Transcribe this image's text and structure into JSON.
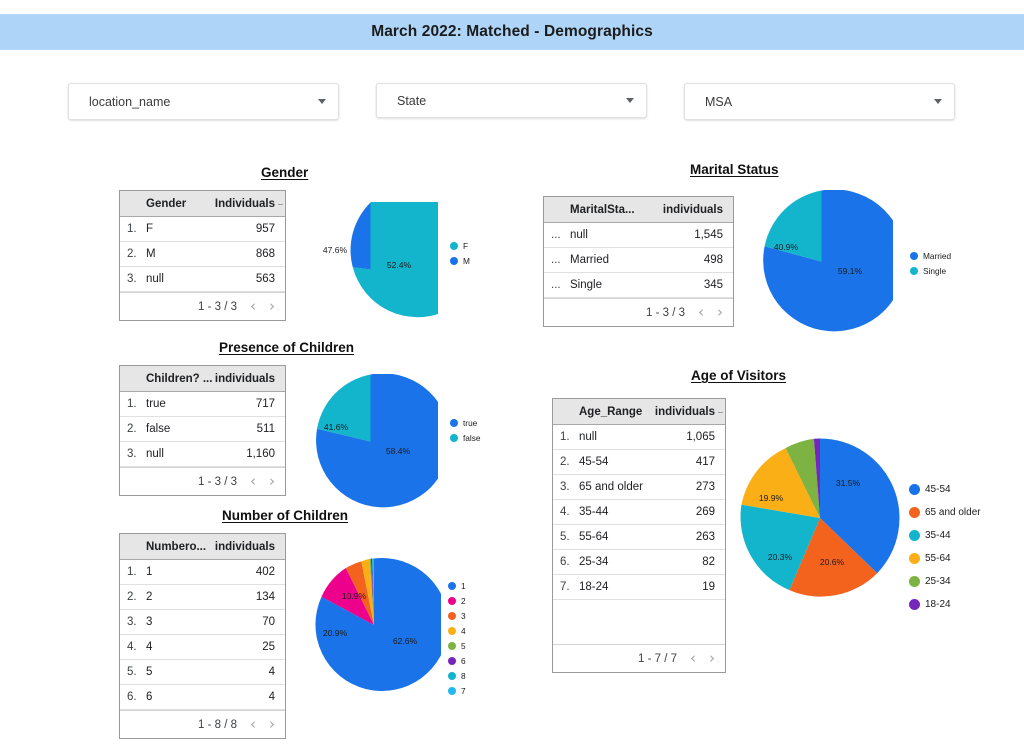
{
  "header": {
    "title": "March 2022: Matched - Demographics",
    "background": "#aed4f7"
  },
  "filters": [
    {
      "name": "location_name",
      "label": "location_name"
    },
    {
      "name": "state",
      "label": "State"
    },
    {
      "name": "msa",
      "label": "MSA"
    }
  ],
  "palette": {
    "blue": "#1a73e8",
    "teal": "#12b5cb",
    "orange": "#f4631e",
    "amber": "#fbaf17",
    "green": "#7cb342",
    "purple": "#7627bb",
    "pink": "#ec008c",
    "cyan": "#12b5cb",
    "lightblue": "#22b7f2"
  },
  "sections": [
    {
      "id": "gender",
      "title": "Gender",
      "table": {
        "columns": [
          "Gender",
          "Individuals"
        ],
        "rows": [
          {
            "n": "1.",
            "key": "F",
            "val": "957"
          },
          {
            "n": "2.",
            "key": "M",
            "val": "868"
          },
          {
            "n": "3.",
            "key": "null",
            "val": "563"
          }
        ],
        "footer": "1 - 3 / 3"
      },
      "chart_data": {
        "type": "pie",
        "title": "Gender",
        "categories": [
          "F",
          "M"
        ],
        "values": [
          957,
          868
        ],
        "percents": [
          "52.4%",
          "47.6%"
        ],
        "colors": [
          "#12b5cb",
          "#1a73e8"
        ],
        "legend_position": "right",
        "note": "null (563) excluded from pie"
      }
    },
    {
      "id": "marital",
      "title": "Marital Status",
      "table": {
        "columns": [
          "MaritalSta...",
          "individuals"
        ],
        "rows": [
          {
            "n": "...",
            "key": "null",
            "val": "1,545"
          },
          {
            "n": "...",
            "key": "Married",
            "val": "498"
          },
          {
            "n": "...",
            "key": "Single",
            "val": "345"
          }
        ],
        "footer": "1 - 3 / 3"
      },
      "chart_data": {
        "type": "pie",
        "title": "Marital Status",
        "categories": [
          "Married",
          "Single"
        ],
        "values": [
          498,
          345
        ],
        "percents": [
          "59.1%",
          "40.9%"
        ],
        "colors": [
          "#1a73e8",
          "#12b5cb"
        ],
        "legend_position": "right",
        "note": "null (1,545) excluded from pie"
      }
    },
    {
      "id": "children",
      "title": "Presence of Children",
      "table": {
        "columns": [
          "Children? ...",
          "individuals"
        ],
        "rows": [
          {
            "n": "1.",
            "key": "true",
            "val": "717"
          },
          {
            "n": "2.",
            "key": "false",
            "val": "511"
          },
          {
            "n": "3.",
            "key": "null",
            "val": "1,160"
          }
        ],
        "footer": "1 - 3 / 3"
      },
      "chart_data": {
        "type": "pie",
        "title": "Presence of Children",
        "categories": [
          "true",
          "false"
        ],
        "values": [
          717,
          511
        ],
        "percents": [
          "58.4%",
          "41.6%"
        ],
        "colors": [
          "#1a73e8",
          "#12b5cb"
        ],
        "legend_position": "right",
        "note": "null (1,160) excluded from pie"
      }
    },
    {
      "id": "numchild",
      "title": "Number of Children",
      "table": {
        "columns": [
          "Numbero...",
          "individuals"
        ],
        "rows": [
          {
            "n": "1.",
            "key": "1",
            "val": "402"
          },
          {
            "n": "2.",
            "key": "2",
            "val": "134"
          },
          {
            "n": "3.",
            "key": "3",
            "val": "70"
          },
          {
            "n": "4.",
            "key": "4",
            "val": "25"
          },
          {
            "n": "5.",
            "key": "5",
            "val": "4"
          },
          {
            "n": "6.",
            "key": "6",
            "val": "4"
          }
        ],
        "footer": "1 - 8 / 8"
      },
      "chart_data": {
        "type": "pie",
        "title": "Number of Children",
        "categories": [
          "1",
          "2",
          "3",
          "4",
          "5",
          "6",
          "8",
          "7"
        ],
        "values": [
          402,
          134,
          70,
          25,
          4,
          4,
          1,
          1
        ],
        "percents": [
          "62.6%",
          "20.9%",
          "10.9%",
          "3.9%",
          "0.6%",
          "0.6%",
          "0.3%",
          "0.2%"
        ],
        "colors": [
          "#1a73e8",
          "#ec008c",
          "#f4631e",
          "#fbaf17",
          "#7cb342",
          "#7627bb",
          "#12b5cb",
          "#22b7f2"
        ],
        "labeled_slices": [
          "62.6%",
          "20.9%",
          "10.9%"
        ],
        "legend_position": "right"
      }
    },
    {
      "id": "age",
      "title": "Age of Visitors",
      "table": {
        "columns": [
          "Age_Range",
          "individuals"
        ],
        "rows": [
          {
            "n": "1.",
            "key": "null",
            "val": "1,065"
          },
          {
            "n": "2.",
            "key": "45-54",
            "val": "417"
          },
          {
            "n": "3.",
            "key": "65 and older",
            "val": "273"
          },
          {
            "n": "4.",
            "key": "35-44",
            "val": "269"
          },
          {
            "n": "5.",
            "key": "55-64",
            "val": "263"
          },
          {
            "n": "6.",
            "key": "25-34",
            "val": "82"
          },
          {
            "n": "7.",
            "key": "18-24",
            "val": "19"
          }
        ],
        "footer": "1 - 7 / 7"
      },
      "chart_data": {
        "type": "pie",
        "title": "Age of Visitors",
        "categories": [
          "45-54",
          "65 and older",
          "35-44",
          "55-64",
          "25-34",
          "18-24"
        ],
        "values": [
          417,
          273,
          269,
          263,
          82,
          19
        ],
        "percents": [
          "31.5%",
          "20.6%",
          "20.3%",
          "19.9%",
          "6.2%",
          "1.4%"
        ],
        "colors": [
          "#1a73e8",
          "#f4631e",
          "#12b5cb",
          "#fbaf17",
          "#7cb342",
          "#7627bb"
        ],
        "labeled_slices": [
          "31.5%",
          "20.6%",
          "20.3%",
          "19.9%"
        ],
        "legend_position": "right",
        "note": "null (1,065) excluded from pie"
      }
    }
  ],
  "pagination_icons": {
    "prev": "‹",
    "next": "›"
  }
}
